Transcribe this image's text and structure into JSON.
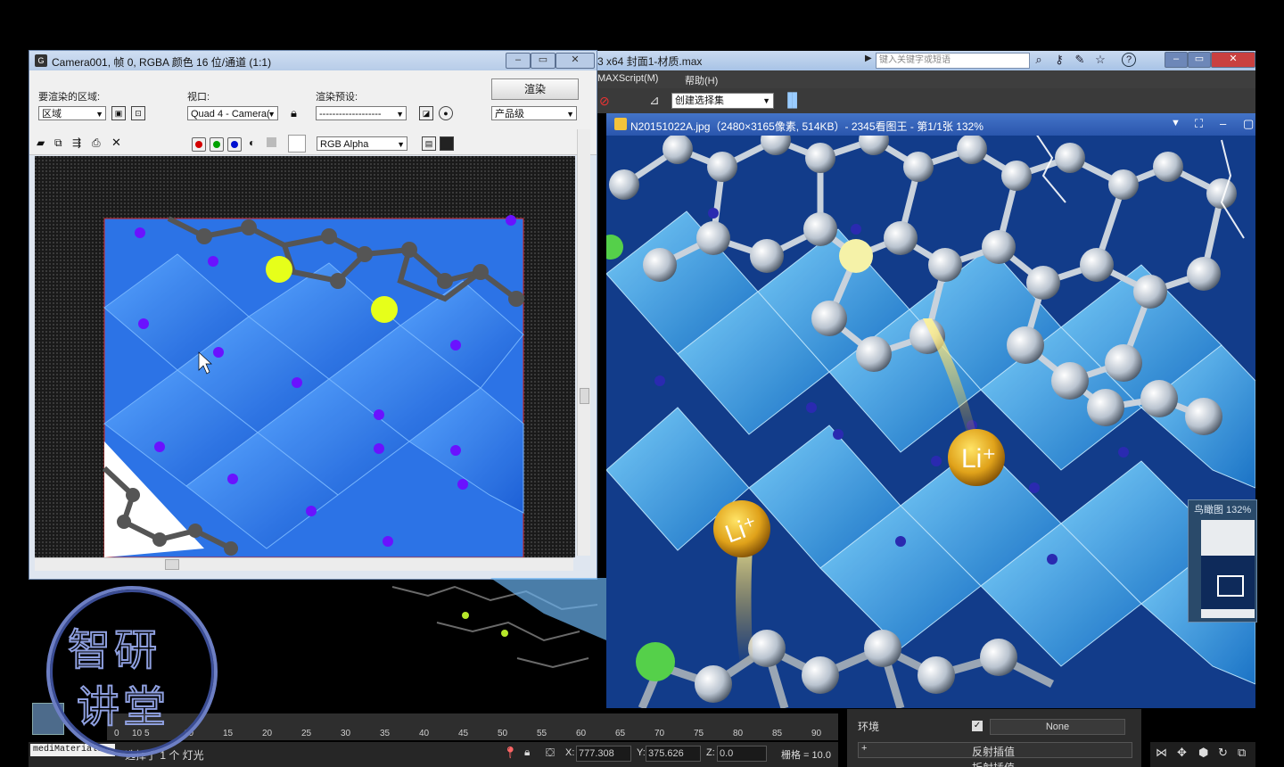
{
  "main_window": {
    "title": "3 x64     封面1-材质.max",
    "search_placeholder": "键入关键字或短语",
    "menus": [
      "MAXScript(M)",
      "帮助(H)"
    ],
    "selection_set": "创建选择集"
  },
  "render_window": {
    "title": "Camera001, 帧 0, RGBA 颜色 16 位/通道 (1:1)",
    "area_label": "要渲染的区域:",
    "area_value": "区域",
    "viewport_label": "视口:",
    "viewport_value": "Quad 4 - Camera(",
    "preset_label": "渲染预设:",
    "preset_value": "-------------------",
    "render_button": "渲染",
    "quality_value": "产品级",
    "channel_value": "RGB Alpha",
    "colors": {
      "red": "#d40000",
      "green": "#00a000",
      "blue": "#0010d0"
    }
  },
  "viewer": {
    "title": "N20151022A.jpg（2480×3165像素, 514KB）- 2345看图王 - 第1/1张 132%",
    "labels": [
      "Li⁺",
      "Li⁺"
    ],
    "nav_title": "鸟瞰图 132%"
  },
  "timeline": {
    "ticks": [
      "0",
      "10",
      "5",
      "10",
      "15",
      "20",
      "25",
      "30",
      "35",
      "40",
      "45",
      "50",
      "55",
      "60",
      "65",
      "70",
      "75",
      "80",
      "85",
      "90"
    ]
  },
  "status": {
    "script_label": "mediMaterials",
    "message": "选择了 1 个 灯光",
    "x_label": "X:",
    "x_value": "777.308",
    "y_label": "Y:",
    "y_value": "375.626",
    "z_label": "Z:",
    "z_value": "0.0",
    "grid": "栅格 = 10.0"
  },
  "right_panel": {
    "env_label": "环境",
    "none_value": "None",
    "reflect_interp": "反射插值",
    "refract_interp": "折射插值"
  },
  "watermark": {
    "line1": "智研",
    "line2": "讲堂"
  }
}
